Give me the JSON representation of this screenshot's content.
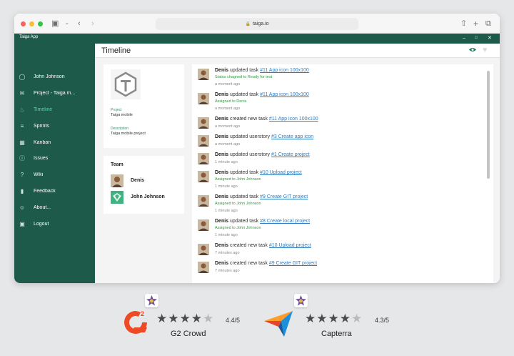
{
  "browser": {
    "url": "taiga.io"
  },
  "app": {
    "title": "Taiga App"
  },
  "sidebar": {
    "items": [
      {
        "label": "John Johnson",
        "icon": "user-icon"
      },
      {
        "label": "Project - Taiga m...",
        "icon": "mail-icon"
      },
      {
        "label": "Timeline",
        "icon": "bell-icon",
        "active": true
      },
      {
        "label": "Sprints",
        "icon": "sprints-icon"
      },
      {
        "label": "Kanban",
        "icon": "calendar-icon"
      },
      {
        "label": "Issues",
        "icon": "info-icon"
      },
      {
        "label": "Wiki",
        "icon": "question-icon"
      },
      {
        "label": "Feedback",
        "icon": "bookmark-icon"
      },
      {
        "label": "About...",
        "icon": "smiley-icon"
      },
      {
        "label": "Logout",
        "icon": "lock-icon"
      }
    ]
  },
  "page": {
    "title": "Timeline"
  },
  "project": {
    "project_label": "Project",
    "project_value": "Taiga mobile",
    "description_label": "Description",
    "description_value": "Taiga mobile project"
  },
  "team": {
    "title": "Team",
    "members": [
      {
        "name": "Denis"
      },
      {
        "name": "John Johnson"
      }
    ]
  },
  "timeline": [
    {
      "user": "Denis",
      "action": "updated task",
      "link": "#11 App icon 100x100",
      "sub": "Status chagned to Ready for test",
      "time": "a moment ago"
    },
    {
      "user": "Denis",
      "action": "updated task",
      "link": "#11 App icon 100x100",
      "sub": "Assigned to Denis",
      "time": "a moment ago"
    },
    {
      "user": "Denis",
      "action": "created new task",
      "link": "#11 App icon 100x100",
      "sub": "",
      "time": "a moment ago"
    },
    {
      "user": "Denis",
      "action": "updated userstory",
      "link": "#3 Create app icon",
      "sub": "",
      "time": "a moment ago"
    },
    {
      "user": "Denis",
      "action": "updated userstory",
      "link": "#1 Create project",
      "sub": "",
      "time": "1 minute ago"
    },
    {
      "user": "Denis",
      "action": "updated task",
      "link": "#10 Upload project",
      "sub": "Assigned to John Johnson",
      "time": "1 minute ago"
    },
    {
      "user": "Denis",
      "action": "updated task",
      "link": "#9 Create GIT project",
      "sub": "Assigned to John Johnson",
      "time": "1 minute ago"
    },
    {
      "user": "Denis",
      "action": "updated task",
      "link": "#8 Create local project",
      "sub": "Assigned to John Johnson",
      "time": "1 minute ago"
    },
    {
      "user": "Denis",
      "action": "created new task",
      "link": "#10 Upload project",
      "sub": "",
      "time": "7 minutes ago"
    },
    {
      "user": "Denis",
      "action": "created new task",
      "link": "#9 Create GIT project",
      "sub": "",
      "time": "7 minutes ago"
    }
  ],
  "ratings": [
    {
      "name": "G2 Crowd",
      "score": "4.4/5",
      "stars": 4.4,
      "logo": "g2-logo"
    },
    {
      "name": "Capterra",
      "score": "4.3/5",
      "stars": 4.3,
      "logo": "capterra-logo"
    }
  ],
  "colors": {
    "sidebar": "#1e5a4a",
    "accent": "#5fd3b0",
    "link": "#2b7cc4",
    "status": "#2e9a3c"
  }
}
